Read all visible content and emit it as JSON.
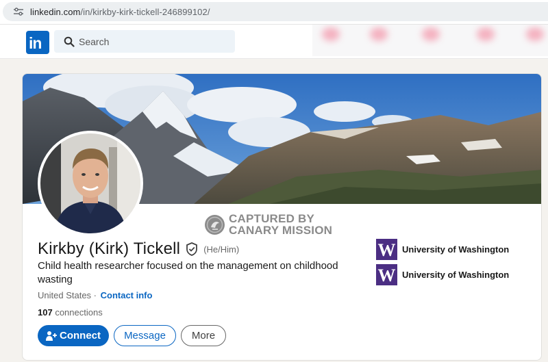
{
  "browser": {
    "url_host": "linkedin.com",
    "url_path": "/in/kirkby-kirk-tickell-246899102/"
  },
  "nav": {
    "logo_text": "in",
    "search_placeholder": "Search"
  },
  "watermark": {
    "line1": "CAPTURED BY",
    "line2": "CANARY MISSION"
  },
  "profile": {
    "name": "Kirkby (Kirk) Tickell",
    "pronouns": "(He/Him)",
    "headline": "Child health researcher focused on the management on childhood wasting",
    "location": "United States",
    "separator": " · ",
    "contact_info": "Contact info",
    "connections_count": "107",
    "connections_label": " connections"
  },
  "actions": {
    "connect": "Connect",
    "message": "Message",
    "more": "More"
  },
  "education": [
    {
      "logo": "W",
      "name": "University of Washington"
    },
    {
      "logo": "W",
      "name": "University of Washington"
    }
  ],
  "colors": {
    "brand": "#0a66c2",
    "uw_purple": "#4b2e83"
  },
  "icons": [
    "tune-icon",
    "search-icon",
    "verified-shield-icon",
    "person-plus-icon",
    "canary-mission-badge-icon"
  ]
}
